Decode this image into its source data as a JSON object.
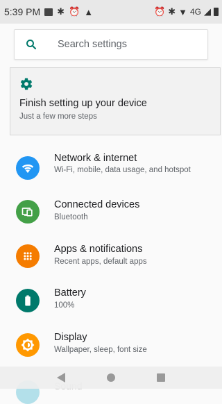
{
  "status_bar": {
    "time": "5:39 PM",
    "left_icons": [
      "image-icon",
      "gear-icon",
      "alarm-icon",
      "warning-icon"
    ],
    "right_icons": [
      "alarm-icon",
      "bluetooth-icon",
      "wifi-signal-icon",
      "cell-signal-icon",
      "battery-icon"
    ],
    "network": "4G"
  },
  "search": {
    "placeholder": "Search settings",
    "icon": "search-icon",
    "accent": "#00796b"
  },
  "setup_card": {
    "icon": "gear-icon",
    "title": "Finish setting up your device",
    "subtitle": "Just a few more steps"
  },
  "settings": [
    {
      "icon": "wifi-icon",
      "color": "#2196f3",
      "title": "Network & internet",
      "subtitle": "Wi-Fi, mobile, data usage, and hotspot"
    },
    {
      "icon": "devices-icon",
      "color": "#43a047",
      "title": "Connected devices",
      "subtitle": "Bluetooth"
    },
    {
      "icon": "apps-icon",
      "color": "#f57c00",
      "title": "Apps & notifications",
      "subtitle": "Recent apps, default apps"
    },
    {
      "icon": "battery-icon",
      "color": "#00796b",
      "title": "Battery",
      "subtitle": "100%"
    },
    {
      "icon": "display-icon",
      "color": "#ff9800",
      "title": "Display",
      "subtitle": "Wallpaper, sleep, font size"
    }
  ],
  "peek_item": {
    "title": "Sound",
    "color": "#00acc1"
  },
  "nav_bar": {
    "buttons": [
      "back-icon",
      "home-icon",
      "recents-icon"
    ]
  }
}
